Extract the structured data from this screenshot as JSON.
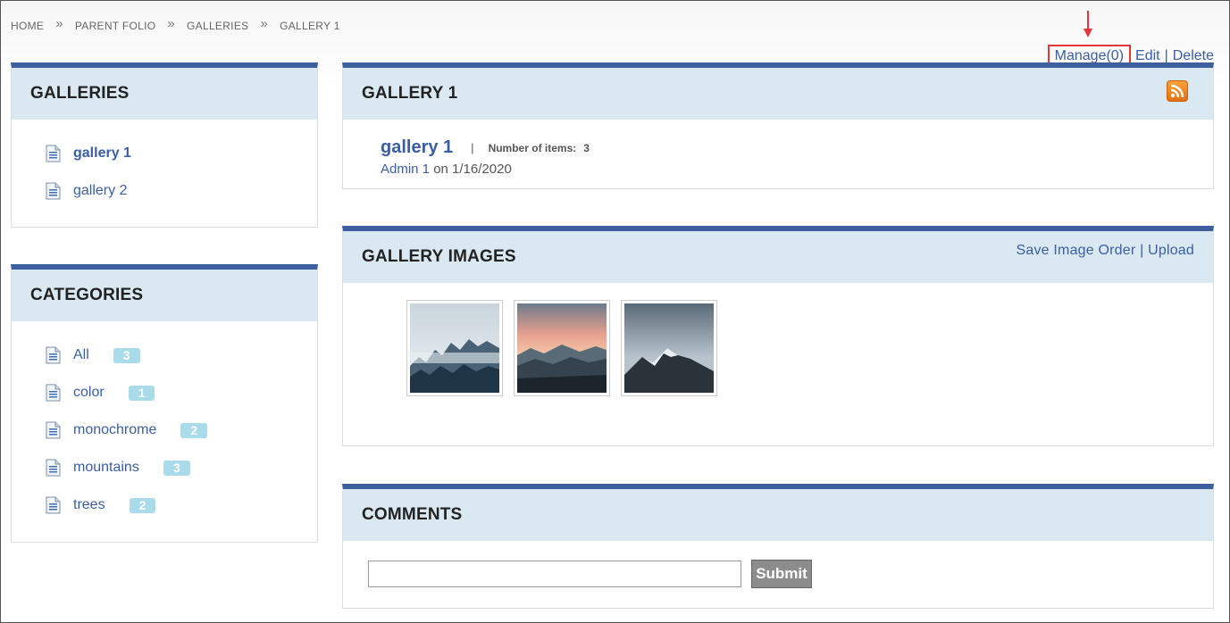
{
  "breadcrumb": {
    "items": [
      "HOME",
      "PARENT FOLIO",
      "GALLERIES",
      "GALLERY 1"
    ],
    "separator": "»"
  },
  "actions": {
    "manage": "Manage(0)",
    "edit": "Edit",
    "delete": "Delete",
    "pipe": "|"
  },
  "galleries_panel": {
    "title": "GALLERIES",
    "items": [
      {
        "label": "gallery 1",
        "active": true
      },
      {
        "label": "gallery 2",
        "active": false
      }
    ]
  },
  "categories_panel": {
    "title": "CATEGORIES",
    "items": [
      {
        "label": "All",
        "count": "3"
      },
      {
        "label": "color",
        "count": "1"
      },
      {
        "label": "monochrome",
        "count": "2"
      },
      {
        "label": "mountains",
        "count": "3"
      },
      {
        "label": "trees",
        "count": "2"
      }
    ]
  },
  "gallery_panel": {
    "title": "GALLERY 1",
    "name": "gallery 1",
    "separator": "|",
    "items_label": "Number of items:",
    "items_count": "3",
    "author": "Admin 1",
    "date_text": " on 1/16/2020",
    "rss_icon": "rss-feed-icon"
  },
  "images_panel": {
    "title": "GALLERY IMAGES",
    "save_order": "Save Image Order",
    "upload": "Upload",
    "pipe": "|"
  },
  "comments_panel": {
    "title": "COMMENTS",
    "submit": "Submit",
    "input_value": ""
  },
  "colors": {
    "accent": "#3d5f9e",
    "panel_header": "#d9e8f1",
    "link": "#3a5ea5",
    "badge": "#a9dbea",
    "highlight": "#e2363b"
  }
}
